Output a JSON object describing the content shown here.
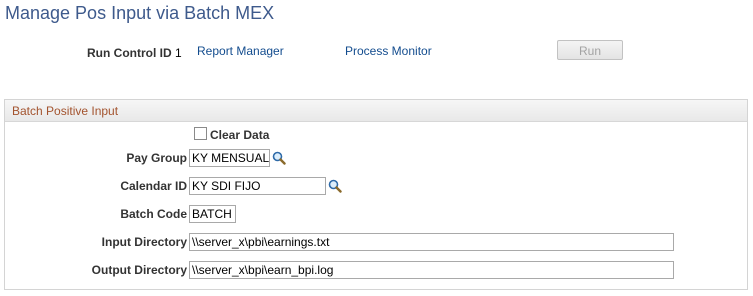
{
  "page": {
    "title": "Manage Pos Input via Batch MEX"
  },
  "run_control": {
    "label": "Run Control ID",
    "value": "1",
    "report_manager": "Report Manager",
    "process_monitor": "Process Monitor",
    "run_button": "Run"
  },
  "batch": {
    "section_title": "Batch Positive Input",
    "clear_data_label": "Clear Data",
    "pay_group_label": "Pay Group",
    "pay_group_value": "KY MENSUAL",
    "calendar_id_label": "Calendar ID",
    "calendar_id_value": "KY SDI FIJO",
    "batch_code_label": "Batch Code",
    "batch_code_value": "BATCH",
    "input_dir_label": "Input Directory",
    "input_dir_value": "\\\\server_x\\pbi\\earnings.txt",
    "output_dir_label": "Output Directory",
    "output_dir_value": "\\\\server_x\\bpi\\earn_bpi.log"
  },
  "icons": {
    "lookup": "magnifier-icon"
  },
  "colors": {
    "title": "#3e5a8c",
    "link": "#134c8e",
    "section_title": "#a3532e"
  }
}
